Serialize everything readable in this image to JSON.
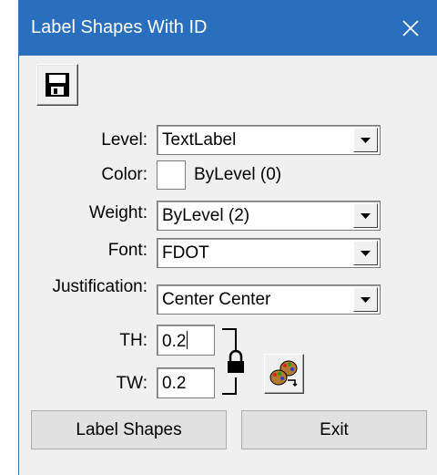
{
  "window": {
    "title": "Label Shapes With ID"
  },
  "icons": {
    "close": "close-icon",
    "save": "floppy-disk-icon",
    "lock": "padlock-icon",
    "apply": "palette-refresh-icon",
    "dropdown": "chevron-down-icon"
  },
  "form": {
    "level": {
      "label": "Level:",
      "value": "TextLabel"
    },
    "color": {
      "label": "Color:",
      "value": "ByLevel (0)",
      "swatch": "#ffffff"
    },
    "weight": {
      "label": "Weight:",
      "value": "ByLevel (2)"
    },
    "font": {
      "label": "Font:",
      "value": "FDOT"
    },
    "justification": {
      "label": "Justification:",
      "value": "Center Center"
    },
    "th": {
      "label": "TH:",
      "value": "0.2"
    },
    "tw": {
      "label": "TW:",
      "value": "0.2"
    }
  },
  "buttons": {
    "label_shapes": "Label Shapes",
    "exit": "Exit"
  },
  "colors": {
    "titlebar": "#2a6fbd",
    "background": "#f0f0f0"
  }
}
